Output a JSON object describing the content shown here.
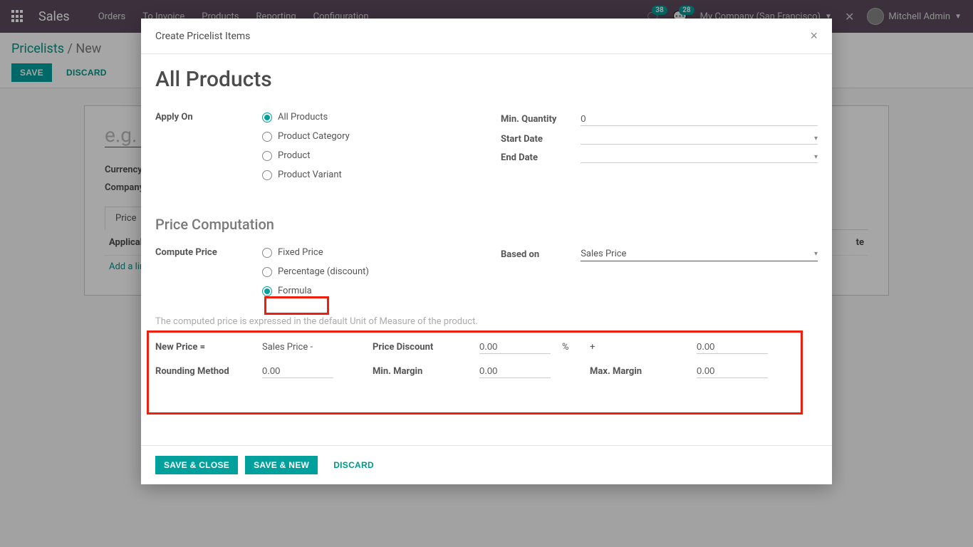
{
  "navbar": {
    "brand": "Sales",
    "menu": [
      "Orders",
      "To Invoice",
      "Products",
      "Reporting",
      "Configuration"
    ],
    "badge1": "38",
    "badge2": "28",
    "company": "My Company (San Francisco)",
    "user": "Mitchell Admin"
  },
  "breadcrumb": {
    "parent": "Pricelists",
    "current": "New"
  },
  "buttons": {
    "save": "Save",
    "discard": "Discard"
  },
  "sheet": {
    "placeholder": "e.g.",
    "currency_label": "Currency",
    "company_label": "Company",
    "tab": "Price ",
    "col_applicable": "Applicable",
    "col_date": "te",
    "add_line": "Add a line"
  },
  "modal": {
    "title": "Create Pricelist Items",
    "heading": "All Products",
    "apply_on_label": "Apply On",
    "apply_options": [
      "All Products",
      "Product Category",
      "Product",
      "Product Variant"
    ],
    "min_qty_label": "Min. Quantity",
    "min_qty_value": "0",
    "start_date_label": "Start Date",
    "end_date_label": "End Date",
    "price_comp_heading": "Price Computation",
    "compute_price_label": "Compute Price",
    "compute_options": [
      "Fixed Price",
      "Percentage (discount)",
      "Formula"
    ],
    "based_on_label": "Based on",
    "based_on_value": "Sales Price",
    "helper": "The computed price is expressed in the default Unit of Measure of the product.",
    "new_price_label": "New Price =",
    "sales_price_minus": "Sales Price -",
    "price_discount_label": "Price Discount",
    "price_discount_value": "0.00",
    "pct_sign": "%",
    "plus_sign": "+",
    "plus_value": "0.00",
    "rounding_label": "Rounding Method",
    "rounding_value": "0.00",
    "min_margin_label": "Min. Margin",
    "min_margin_value": "0.00",
    "max_margin_label": "Max. Margin",
    "max_margin_value": "0.00",
    "save_close": "Save & Close",
    "save_new": "Save & New",
    "discard": "Discard"
  }
}
